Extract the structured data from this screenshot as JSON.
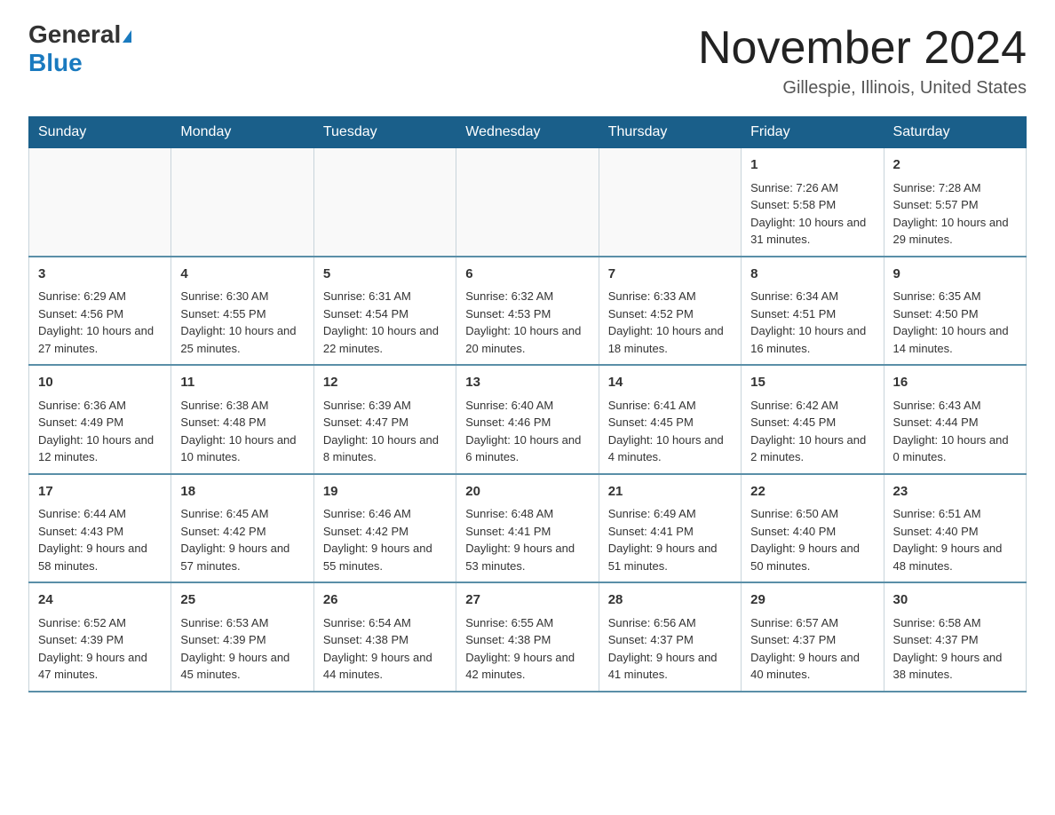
{
  "header": {
    "logo_line1": "General",
    "logo_line2": "Blue",
    "main_title": "November 2024",
    "subtitle": "Gillespie, Illinois, United States"
  },
  "days_of_week": [
    "Sunday",
    "Monday",
    "Tuesday",
    "Wednesday",
    "Thursday",
    "Friday",
    "Saturday"
  ],
  "weeks": [
    [
      {
        "day": "",
        "sunrise": "",
        "sunset": "",
        "daylight": "",
        "empty": true
      },
      {
        "day": "",
        "sunrise": "",
        "sunset": "",
        "daylight": "",
        "empty": true
      },
      {
        "day": "",
        "sunrise": "",
        "sunset": "",
        "daylight": "",
        "empty": true
      },
      {
        "day": "",
        "sunrise": "",
        "sunset": "",
        "daylight": "",
        "empty": true
      },
      {
        "day": "",
        "sunrise": "",
        "sunset": "",
        "daylight": "",
        "empty": true
      },
      {
        "day": "1",
        "sunrise": "Sunrise: 7:26 AM",
        "sunset": "Sunset: 5:58 PM",
        "daylight": "Daylight: 10 hours and 31 minutes.",
        "empty": false
      },
      {
        "day": "2",
        "sunrise": "Sunrise: 7:28 AM",
        "sunset": "Sunset: 5:57 PM",
        "daylight": "Daylight: 10 hours and 29 minutes.",
        "empty": false
      }
    ],
    [
      {
        "day": "3",
        "sunrise": "Sunrise: 6:29 AM",
        "sunset": "Sunset: 4:56 PM",
        "daylight": "Daylight: 10 hours and 27 minutes.",
        "empty": false
      },
      {
        "day": "4",
        "sunrise": "Sunrise: 6:30 AM",
        "sunset": "Sunset: 4:55 PM",
        "daylight": "Daylight: 10 hours and 25 minutes.",
        "empty": false
      },
      {
        "day": "5",
        "sunrise": "Sunrise: 6:31 AM",
        "sunset": "Sunset: 4:54 PM",
        "daylight": "Daylight: 10 hours and 22 minutes.",
        "empty": false
      },
      {
        "day": "6",
        "sunrise": "Sunrise: 6:32 AM",
        "sunset": "Sunset: 4:53 PM",
        "daylight": "Daylight: 10 hours and 20 minutes.",
        "empty": false
      },
      {
        "day": "7",
        "sunrise": "Sunrise: 6:33 AM",
        "sunset": "Sunset: 4:52 PM",
        "daylight": "Daylight: 10 hours and 18 minutes.",
        "empty": false
      },
      {
        "day": "8",
        "sunrise": "Sunrise: 6:34 AM",
        "sunset": "Sunset: 4:51 PM",
        "daylight": "Daylight: 10 hours and 16 minutes.",
        "empty": false
      },
      {
        "day": "9",
        "sunrise": "Sunrise: 6:35 AM",
        "sunset": "Sunset: 4:50 PM",
        "daylight": "Daylight: 10 hours and 14 minutes.",
        "empty": false
      }
    ],
    [
      {
        "day": "10",
        "sunrise": "Sunrise: 6:36 AM",
        "sunset": "Sunset: 4:49 PM",
        "daylight": "Daylight: 10 hours and 12 minutes.",
        "empty": false
      },
      {
        "day": "11",
        "sunrise": "Sunrise: 6:38 AM",
        "sunset": "Sunset: 4:48 PM",
        "daylight": "Daylight: 10 hours and 10 minutes.",
        "empty": false
      },
      {
        "day": "12",
        "sunrise": "Sunrise: 6:39 AM",
        "sunset": "Sunset: 4:47 PM",
        "daylight": "Daylight: 10 hours and 8 minutes.",
        "empty": false
      },
      {
        "day": "13",
        "sunrise": "Sunrise: 6:40 AM",
        "sunset": "Sunset: 4:46 PM",
        "daylight": "Daylight: 10 hours and 6 minutes.",
        "empty": false
      },
      {
        "day": "14",
        "sunrise": "Sunrise: 6:41 AM",
        "sunset": "Sunset: 4:45 PM",
        "daylight": "Daylight: 10 hours and 4 minutes.",
        "empty": false
      },
      {
        "day": "15",
        "sunrise": "Sunrise: 6:42 AM",
        "sunset": "Sunset: 4:45 PM",
        "daylight": "Daylight: 10 hours and 2 minutes.",
        "empty": false
      },
      {
        "day": "16",
        "sunrise": "Sunrise: 6:43 AM",
        "sunset": "Sunset: 4:44 PM",
        "daylight": "Daylight: 10 hours and 0 minutes.",
        "empty": false
      }
    ],
    [
      {
        "day": "17",
        "sunrise": "Sunrise: 6:44 AM",
        "sunset": "Sunset: 4:43 PM",
        "daylight": "Daylight: 9 hours and 58 minutes.",
        "empty": false
      },
      {
        "day": "18",
        "sunrise": "Sunrise: 6:45 AM",
        "sunset": "Sunset: 4:42 PM",
        "daylight": "Daylight: 9 hours and 57 minutes.",
        "empty": false
      },
      {
        "day": "19",
        "sunrise": "Sunrise: 6:46 AM",
        "sunset": "Sunset: 4:42 PM",
        "daylight": "Daylight: 9 hours and 55 minutes.",
        "empty": false
      },
      {
        "day": "20",
        "sunrise": "Sunrise: 6:48 AM",
        "sunset": "Sunset: 4:41 PM",
        "daylight": "Daylight: 9 hours and 53 minutes.",
        "empty": false
      },
      {
        "day": "21",
        "sunrise": "Sunrise: 6:49 AM",
        "sunset": "Sunset: 4:41 PM",
        "daylight": "Daylight: 9 hours and 51 minutes.",
        "empty": false
      },
      {
        "day": "22",
        "sunrise": "Sunrise: 6:50 AM",
        "sunset": "Sunset: 4:40 PM",
        "daylight": "Daylight: 9 hours and 50 minutes.",
        "empty": false
      },
      {
        "day": "23",
        "sunrise": "Sunrise: 6:51 AM",
        "sunset": "Sunset: 4:40 PM",
        "daylight": "Daylight: 9 hours and 48 minutes.",
        "empty": false
      }
    ],
    [
      {
        "day": "24",
        "sunrise": "Sunrise: 6:52 AM",
        "sunset": "Sunset: 4:39 PM",
        "daylight": "Daylight: 9 hours and 47 minutes.",
        "empty": false
      },
      {
        "day": "25",
        "sunrise": "Sunrise: 6:53 AM",
        "sunset": "Sunset: 4:39 PM",
        "daylight": "Daylight: 9 hours and 45 minutes.",
        "empty": false
      },
      {
        "day": "26",
        "sunrise": "Sunrise: 6:54 AM",
        "sunset": "Sunset: 4:38 PM",
        "daylight": "Daylight: 9 hours and 44 minutes.",
        "empty": false
      },
      {
        "day": "27",
        "sunrise": "Sunrise: 6:55 AM",
        "sunset": "Sunset: 4:38 PM",
        "daylight": "Daylight: 9 hours and 42 minutes.",
        "empty": false
      },
      {
        "day": "28",
        "sunrise": "Sunrise: 6:56 AM",
        "sunset": "Sunset: 4:37 PM",
        "daylight": "Daylight: 9 hours and 41 minutes.",
        "empty": false
      },
      {
        "day": "29",
        "sunrise": "Sunrise: 6:57 AM",
        "sunset": "Sunset: 4:37 PM",
        "daylight": "Daylight: 9 hours and 40 minutes.",
        "empty": false
      },
      {
        "day": "30",
        "sunrise": "Sunrise: 6:58 AM",
        "sunset": "Sunset: 4:37 PM",
        "daylight": "Daylight: 9 hours and 38 minutes.",
        "empty": false
      }
    ]
  ]
}
